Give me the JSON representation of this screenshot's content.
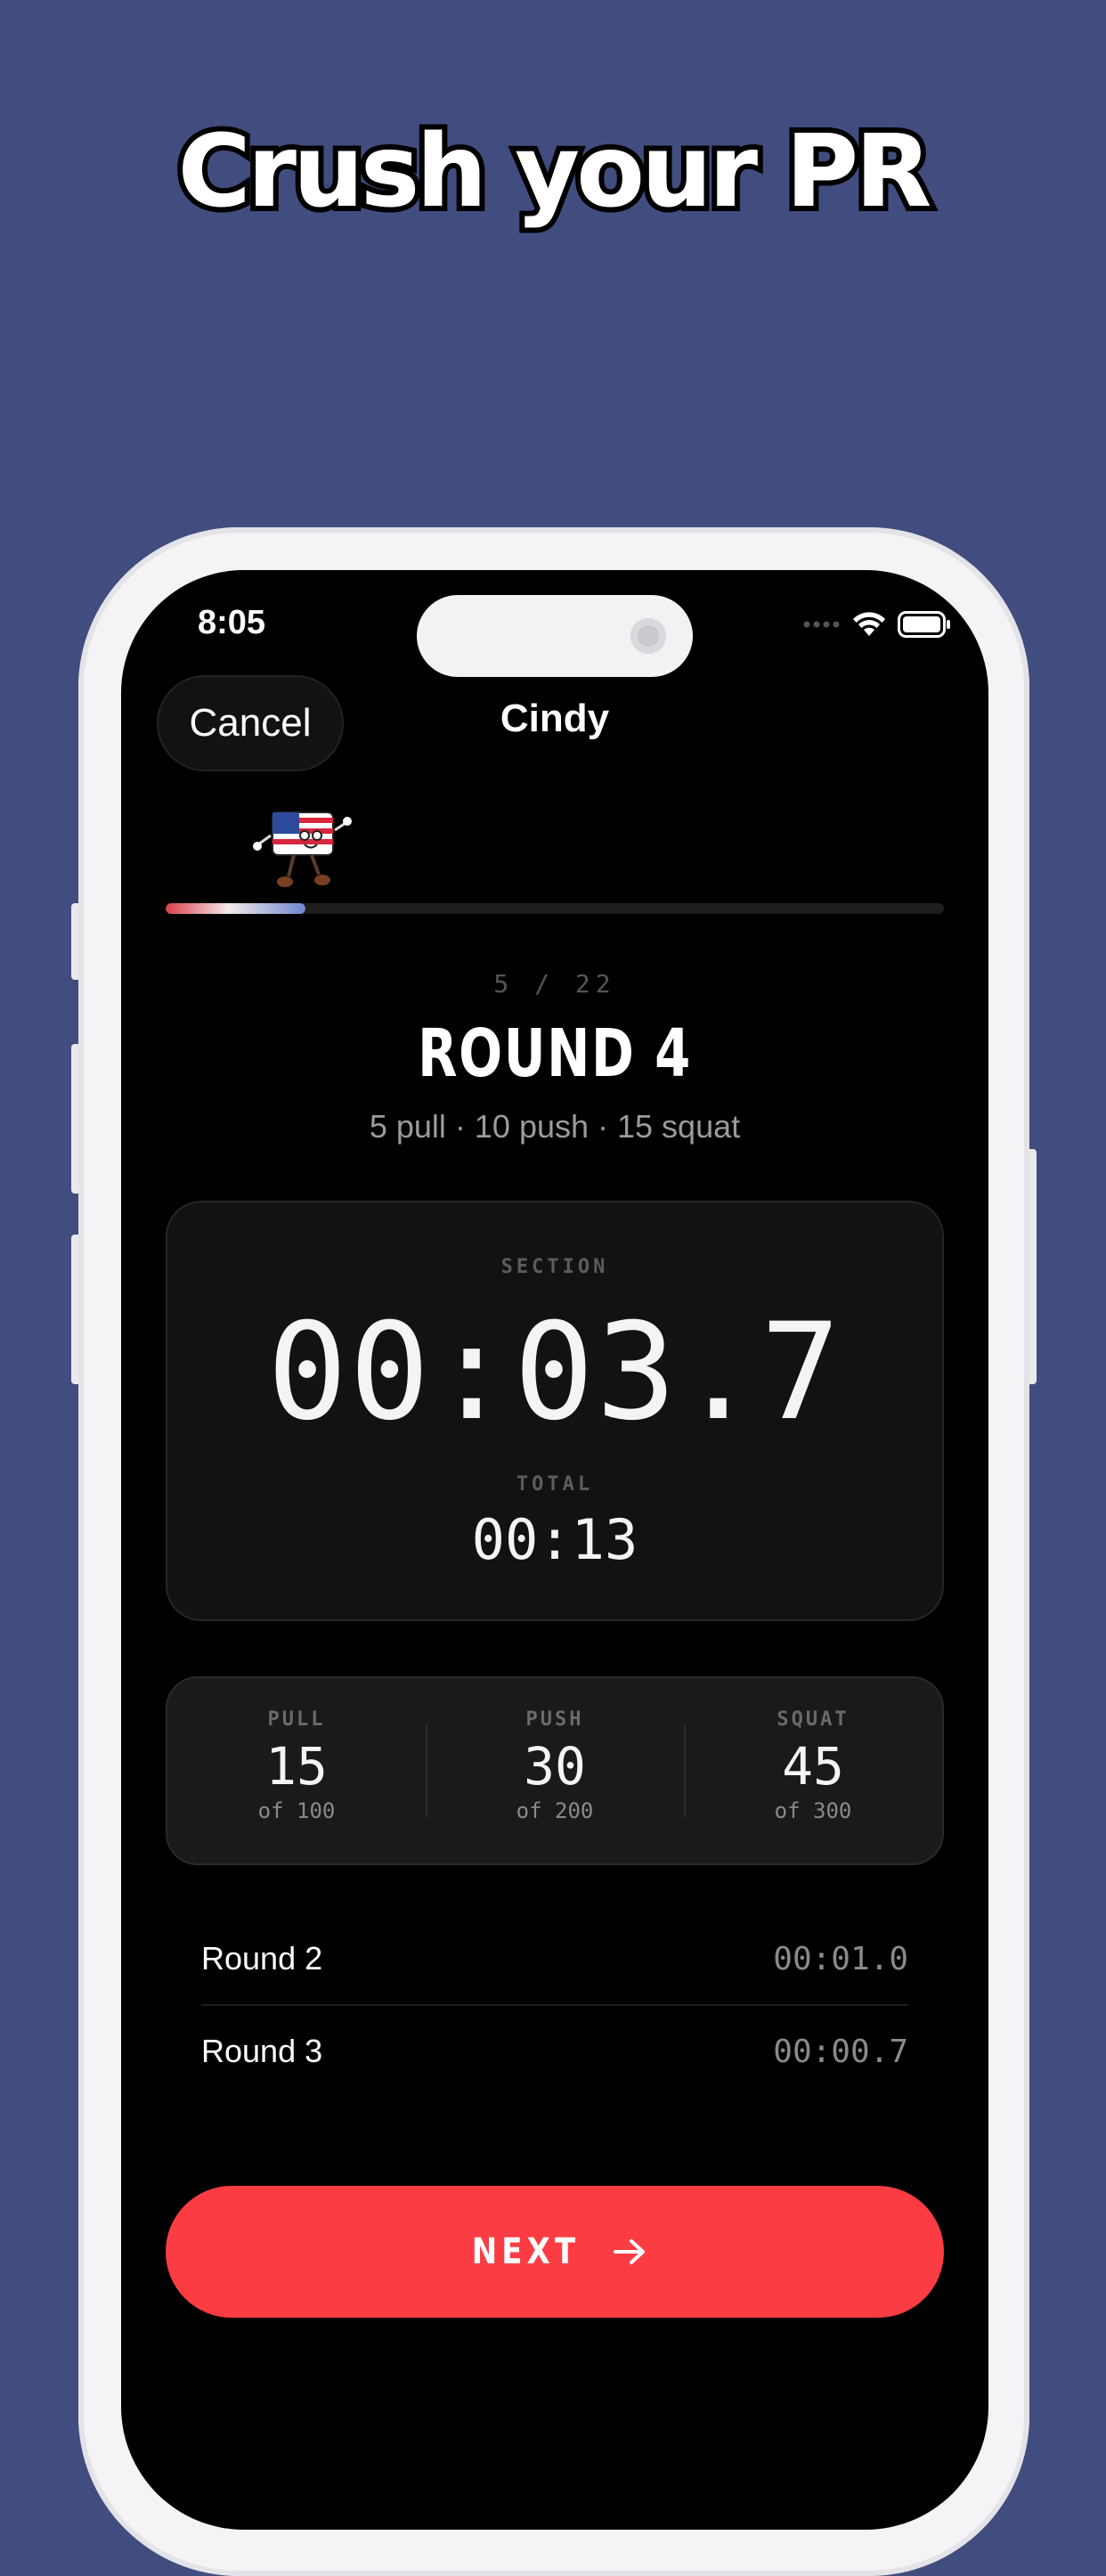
{
  "headline": "Crush your PR",
  "status_bar": {
    "time": "8:05"
  },
  "nav": {
    "cancel_label": "Cancel",
    "title": "Cindy"
  },
  "progress": {
    "fraction": 0.18
  },
  "workout": {
    "step": "5 / 22",
    "round_title": "ROUND 4",
    "round_subtitle": "5 pull · 10 push · 15 squat"
  },
  "timer": {
    "section_label": "SECTION",
    "section_time": "00:03.7",
    "total_label": "TOTAL",
    "total_time": "00:13"
  },
  "reps": [
    {
      "label": "PULL",
      "value": "15",
      "of": "of 100"
    },
    {
      "label": "PUSH",
      "value": "30",
      "of": "of 200"
    },
    {
      "label": "SQUAT",
      "value": "45",
      "of": "of 300"
    }
  ],
  "history": [
    {
      "name": "Round 2",
      "time": "00:01.0"
    },
    {
      "name": "Round 3",
      "time": "00:00.7"
    }
  ],
  "next_button": {
    "label": "NEXT",
    "icon": "arrow-right-icon"
  },
  "colors": {
    "background": "#414d7f",
    "accent": "#fc3c43",
    "screen": "#000000"
  }
}
